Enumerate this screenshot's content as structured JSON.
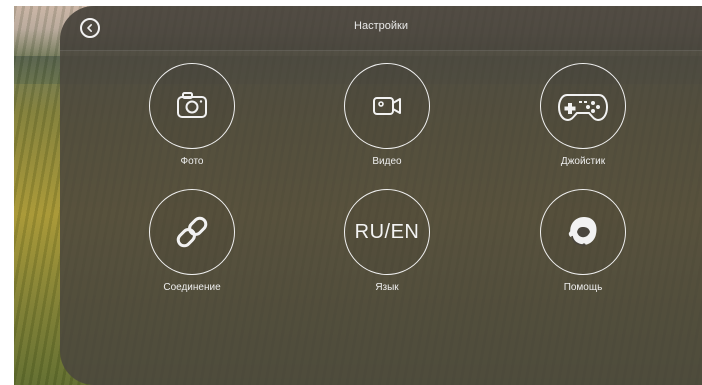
{
  "header": {
    "title": "Настройки",
    "back_icon": "back-arrow-circle-icon"
  },
  "tiles": [
    {
      "label": "Фото",
      "icon": "camera-icon"
    },
    {
      "label": "Видео",
      "icon": "video-camera-icon"
    },
    {
      "label": "Джойстик",
      "icon": "gamepad-icon"
    },
    {
      "label": "Соединение",
      "icon": "link-chain-icon"
    },
    {
      "label": "Язык",
      "icon_text": "RU/EN"
    },
    {
      "label": "Помощь",
      "icon": "support-headset-icon"
    }
  ],
  "colors": {
    "panel": "#4a463e",
    "outline": "#f0f0f0",
    "text": "#eeeeee"
  }
}
